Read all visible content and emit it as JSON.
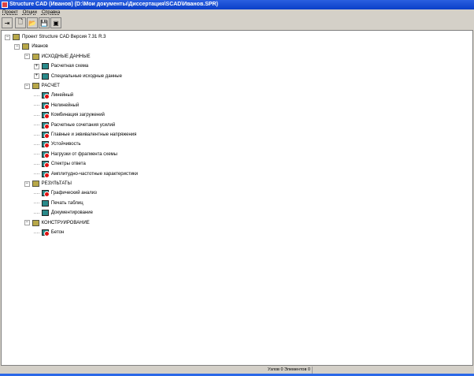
{
  "window": {
    "title": "Structure CAD (Иванов) (D:\\Мои документы\\Диссертация\\SCAD\\Иванов.SPR)"
  },
  "menu": [
    "Проект",
    "Опции",
    "Справка"
  ],
  "toolbar": [
    {
      "icon": "exit-icon",
      "glyph": "⇥"
    },
    {
      "icon": "new-file-icon",
      "glyph": "🗋"
    },
    {
      "icon": "open-folder-icon",
      "glyph": "📂"
    },
    {
      "icon": "save-icon",
      "glyph": "💾"
    },
    {
      "icon": "window-icon",
      "glyph": "▣"
    }
  ],
  "tree": [
    {
      "label": "Проект Structure CAD Версия 7.31 R.3",
      "level": 0,
      "expander": "−",
      "icon": "folder"
    },
    {
      "label": "Иванов",
      "level": 1,
      "expander": "−",
      "icon": "folder"
    },
    {
      "label": "ИСХОДНЫЕ ДАННЫЕ",
      "level": 2,
      "expander": "−",
      "icon": "folder"
    },
    {
      "label": "Расчетная схема",
      "level": 3,
      "expander": "+",
      "icon": "comp"
    },
    {
      "label": "Специальные исходные данные",
      "level": 3,
      "expander": "+",
      "icon": "comp"
    },
    {
      "label": "РАСЧЕТ",
      "level": 2,
      "expander": "−",
      "icon": "folder"
    },
    {
      "label": "Линейный",
      "level": 3,
      "icon": "comp-red"
    },
    {
      "label": "Нелинейный",
      "level": 3,
      "icon": "comp-red"
    },
    {
      "label": "Комбинация загружений",
      "level": 3,
      "icon": "comp-red"
    },
    {
      "label": "Расчетные сочетания усилий",
      "level": 3,
      "icon": "comp-red"
    },
    {
      "label": "Главные и эквивалентные напряжения",
      "level": 3,
      "icon": "comp-red"
    },
    {
      "label": "Устойчивость",
      "level": 3,
      "icon": "comp-red"
    },
    {
      "label": "Нагрузки от фрагмента схемы",
      "level": 3,
      "icon": "comp-red"
    },
    {
      "label": "Спектры ответа",
      "level": 3,
      "icon": "comp-red"
    },
    {
      "label": "Амплитудно-частотные характеристики",
      "level": 3,
      "icon": "comp-red"
    },
    {
      "label": "РЕЗУЛЬТАТЫ",
      "level": 2,
      "expander": "−",
      "icon": "folder"
    },
    {
      "label": "Графический анализ",
      "level": 3,
      "icon": "comp-red"
    },
    {
      "label": "Печать таблиц",
      "level": 3,
      "icon": "comp"
    },
    {
      "label": "Документирование",
      "level": 3,
      "icon": "comp"
    },
    {
      "label": "КОНСТРУИРОВАНИЕ",
      "level": 2,
      "expander": "−",
      "icon": "folder"
    },
    {
      "label": "Бетон",
      "level": 3,
      "icon": "comp-red"
    }
  ],
  "status": {
    "text": "Узлов 0 Элементов 0"
  }
}
